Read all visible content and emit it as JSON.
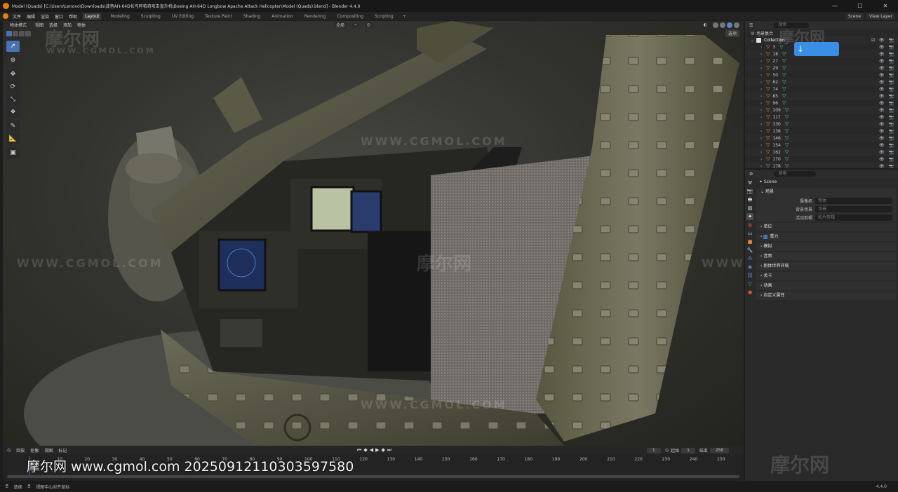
{
  "titlebar": {
    "title": "Model (Quads) [C:\\Users\\Lenovo\\Downloads\\波音AH-64D长弓阿帕奇攻击直升机\\Boeing AH-64D Longbow Apache Attack Helicopter\\Model (Quads).blend] - Blender 4.4.0",
    "minimize": "—",
    "maximize": "☐",
    "close": "✕"
  },
  "menubar": {
    "menus": [
      "文件",
      "编辑",
      "渲染",
      "窗口",
      "帮助"
    ],
    "workspaces": [
      "Layout",
      "Modeling",
      "Sculpting",
      "UV Editing",
      "Texture Paint",
      "Shading",
      "Animation",
      "Rendering",
      "Compositing",
      "Scripting"
    ],
    "add_workspace": "+",
    "scene": "Scene",
    "view_layer": "View Layer"
  },
  "viewport": {
    "mode": "物体模式",
    "menus": [
      "视图",
      "选择",
      "添加",
      "物体"
    ],
    "transform": "全局",
    "select_button": "选项",
    "tools": [
      "select",
      "cursor",
      "move",
      "rotate",
      "scale",
      "transform",
      "annotate",
      "measure",
      "add-cube"
    ]
  },
  "watermarks": {
    "brand": "摩尔网",
    "url": "WWW.CGMOL.COM"
  },
  "timeline": {
    "menus": [
      "回放",
      "抠像",
      "视图",
      "标记"
    ],
    "current_frame": "1",
    "start_label": "起始",
    "start": "1",
    "end_label": "结束",
    "end": "250",
    "ruler": [
      "10",
      "20",
      "30",
      "40",
      "50",
      "60",
      "70",
      "80",
      "90",
      "100",
      "110",
      "120",
      "130",
      "140",
      "150",
      "160",
      "170",
      "180",
      "190",
      "200",
      "210",
      "220",
      "230",
      "240",
      "250"
    ]
  },
  "overlay_text": "摩尔网 www.cgmol.com 20250912110303597580",
  "statusbar": {
    "select": "选择",
    "center": "视图中心对齐鼠标",
    "version": "4.4.0"
  },
  "outliner": {
    "search_placeholder": "搜索",
    "scene_collection": "场景集合",
    "collection": "Collection",
    "items": [
      "3",
      "18",
      "27",
      "29",
      "50",
      "62",
      "74",
      "85",
      "96",
      "109",
      "117",
      "130",
      "138",
      "146",
      "154",
      "162",
      "170",
      "178"
    ]
  },
  "properties": {
    "search_placeholder": "搜索",
    "scene_name": "Scene",
    "panel_scene": "场景",
    "camera_label": "摄像机",
    "camera_value": "物体",
    "background_label": "背景场景",
    "background_value": "场景",
    "clip_label": "活动剪辑",
    "clip_value": "影片剪辑",
    "panels": [
      "单位",
      "重力",
      "模拟",
      "音频",
      "刚体世界环境",
      "关卡",
      "动画",
      "自定义属性"
    ]
  },
  "colors": {
    "accent": "#4772b3",
    "blender_orange": "#e87d0d",
    "mesh_orange": "#e8903b",
    "data_green": "#5fc99a"
  }
}
